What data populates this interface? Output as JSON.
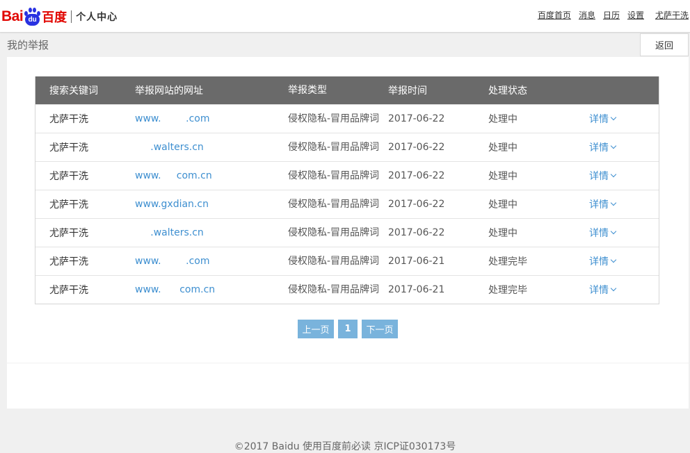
{
  "header": {
    "logo": {
      "bai": "Bai",
      "du": "du",
      "baidu_cn": "百度",
      "section": "个人中心"
    },
    "nav": [
      "百度首页",
      "消息",
      "日历",
      "设置"
    ],
    "user": "尤萨干洗"
  },
  "subheader": {
    "title": "我的举报",
    "back_label": "返回"
  },
  "table": {
    "columns": [
      "搜索关键词",
      "举报网站的网址",
      "举报类型",
      "举报时间",
      "处理状态"
    ],
    "detail_label": "详情",
    "rows": [
      {
        "keyword": "尤萨干洗",
        "url": "www.        .com",
        "type": "侵权隐私-冒用品牌词",
        "time": "2017-06-22",
        "status": "处理中"
      },
      {
        "keyword": "尤萨干洗",
        "url": "     .walters.cn",
        "type": "侵权隐私-冒用品牌词",
        "time": "2017-06-22",
        "status": "处理中"
      },
      {
        "keyword": "尤萨干洗",
        "url": "www.     com.cn",
        "type": "侵权隐私-冒用品牌词",
        "time": "2017-06-22",
        "status": "处理中"
      },
      {
        "keyword": "尤萨干洗",
        "url": "www.gxdian.cn",
        "type": "侵权隐私-冒用品牌词",
        "time": "2017-06-22",
        "status": "处理中"
      },
      {
        "keyword": "尤萨干洗",
        "url": "     .walters.cn",
        "type": "侵权隐私-冒用品牌词",
        "time": "2017-06-22",
        "status": "处理中"
      },
      {
        "keyword": "尤萨干洗",
        "url": "www.        .com",
        "type": "侵权隐私-冒用品牌词",
        "time": "2017-06-21",
        "status": "处理完毕"
      },
      {
        "keyword": "尤萨干洗",
        "url": "www.      com.cn",
        "type": "侵权隐私-冒用品牌词",
        "time": "2017-06-21",
        "status": "处理完毕"
      }
    ]
  },
  "pager": {
    "prev": "上一页",
    "current": "1",
    "next": "下一页"
  },
  "footer": {
    "text": "©2017 Baidu 使用百度前必读 京ICP证030173号"
  }
}
